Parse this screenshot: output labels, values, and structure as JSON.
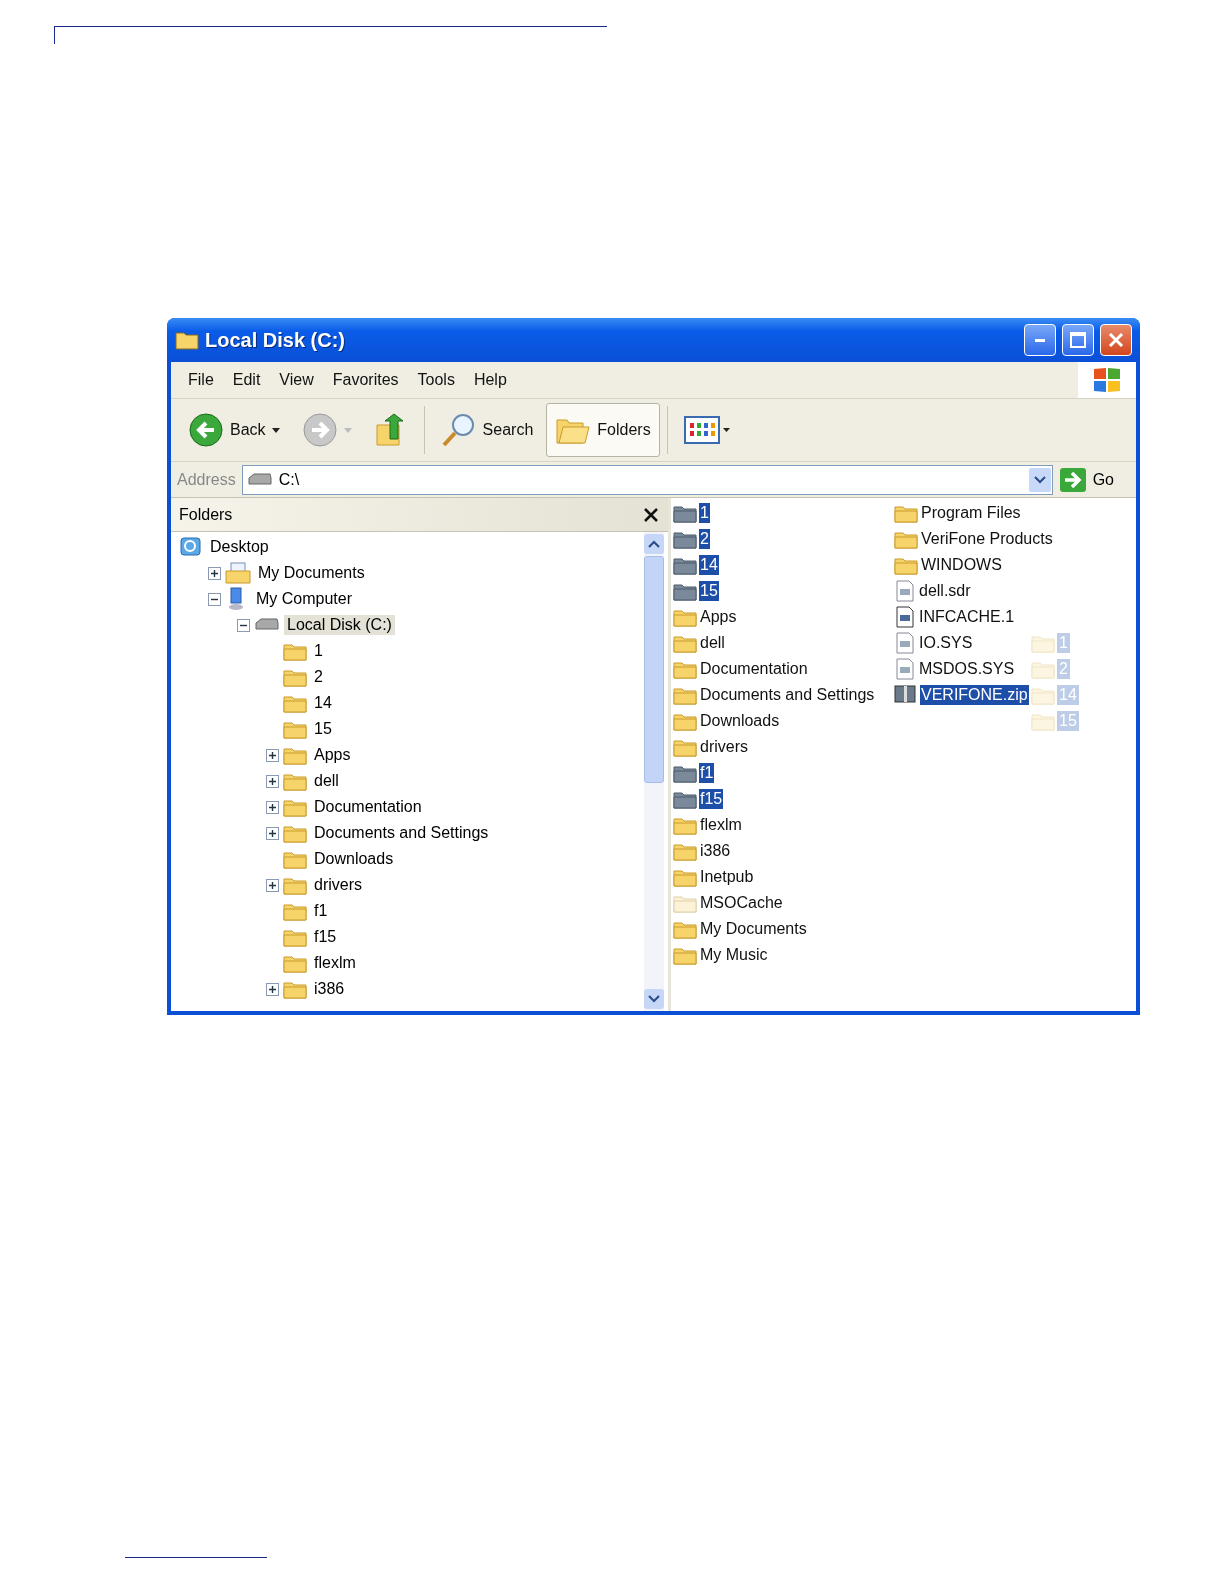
{
  "window": {
    "title": "Local Disk (C:)"
  },
  "menu": [
    "File",
    "Edit",
    "View",
    "Favorites",
    "Tools",
    "Help"
  ],
  "toolbar": [
    {
      "kind": "back",
      "label": "Back",
      "disabled": false
    },
    {
      "kind": "forward",
      "disabled": true
    },
    {
      "kind": "up"
    },
    {
      "kind": "search",
      "label": "Search",
      "selected": false
    },
    {
      "kind": "folders",
      "label": "Folders",
      "selected": true
    },
    {
      "kind": "views"
    }
  ],
  "address": {
    "label": "Address",
    "value": "C:\\",
    "go": "Go"
  },
  "folders_pane": {
    "title": "Folders",
    "tree": [
      {
        "label": "Desktop",
        "kind": "desktop",
        "selected": false,
        "children": [
          {
            "label": "My Documents",
            "kind": "documents",
            "expanded": false,
            "selected": false
          },
          {
            "label": "My Computer",
            "kind": "computer",
            "expanded": true,
            "selected": false,
            "children": [
              {
                "label": "Local Disk (C:)",
                "kind": "drive",
                "expanded": true,
                "selected": true,
                "children": [
                  {
                    "label": "1",
                    "kind": "folder",
                    "selected": false
                  },
                  {
                    "label": "2",
                    "kind": "folder",
                    "selected": false
                  },
                  {
                    "label": "14",
                    "kind": "folder",
                    "selected": false
                  },
                  {
                    "label": "15",
                    "kind": "folder",
                    "selected": false
                  },
                  {
                    "label": "Apps",
                    "kind": "folder",
                    "expanded": false,
                    "selected": false
                  },
                  {
                    "label": "dell",
                    "kind": "folder",
                    "expanded": false,
                    "selected": false
                  },
                  {
                    "label": "Documentation",
                    "kind": "folder",
                    "expanded": false,
                    "selected": false
                  },
                  {
                    "label": "Documents and Settings",
                    "kind": "folder",
                    "expanded": false,
                    "selected": false
                  },
                  {
                    "label": "Downloads",
                    "kind": "folder",
                    "selected": false
                  },
                  {
                    "label": "drivers",
                    "kind": "folder",
                    "expanded": false,
                    "selected": false
                  },
                  {
                    "label": "f1",
                    "kind": "folder",
                    "selected": false
                  },
                  {
                    "label": "f15",
                    "kind": "folder",
                    "selected": false
                  },
                  {
                    "label": "flexlm",
                    "kind": "folder",
                    "selected": false
                  },
                  {
                    "label": "i386",
                    "kind": "folder",
                    "expanded": false,
                    "selected": false
                  }
                ]
              }
            ]
          }
        ]
      }
    ]
  },
  "files": [
    {
      "name": "1",
      "kind": "folder",
      "selected": true
    },
    {
      "name": "2",
      "kind": "folder",
      "selected": true
    },
    {
      "name": "14",
      "kind": "folder",
      "selected": true
    },
    {
      "name": "15",
      "kind": "folder",
      "selected": true
    },
    {
      "name": "Apps",
      "kind": "folder",
      "selected": false
    },
    {
      "name": "dell",
      "kind": "folder",
      "selected": false
    },
    {
      "name": "Documentation",
      "kind": "folder",
      "selected": false
    },
    {
      "name": "Documents and Settings",
      "kind": "folder",
      "selected": false
    },
    {
      "name": "Downloads",
      "kind": "folder",
      "selected": false
    },
    {
      "name": "drivers",
      "kind": "folder",
      "selected": false
    },
    {
      "name": "f1",
      "kind": "folder",
      "selected": true
    },
    {
      "name": "f15",
      "kind": "folder",
      "selected": true
    },
    {
      "name": "flexlm",
      "kind": "folder",
      "selected": false
    },
    {
      "name": "i386",
      "kind": "folder",
      "selected": false
    },
    {
      "name": "Inetpub",
      "kind": "folder",
      "selected": false
    },
    {
      "name": "MSOCache",
      "kind": "hidden-folder",
      "selected": false
    },
    {
      "name": "My Documents",
      "kind": "folder",
      "selected": false
    },
    {
      "name": "My Music",
      "kind": "folder",
      "selected": false
    },
    {
      "name": "Program Files",
      "kind": "folder",
      "selected": false
    },
    {
      "name": "VeriFone Products",
      "kind": "folder",
      "selected": false
    },
    {
      "name": "WINDOWS",
      "kind": "folder",
      "selected": false
    },
    {
      "name": "dell.sdr",
      "kind": "file",
      "selected": false
    },
    {
      "name": "INFCACHE.1",
      "kind": "system-file",
      "selected": false
    },
    {
      "name": "IO.SYS",
      "kind": "file",
      "selected": false
    },
    {
      "name": "MSDOS.SYS",
      "kind": "file",
      "selected": false
    },
    {
      "name": "VERIFONE.zip",
      "kind": "zip",
      "selected": true
    }
  ],
  "drag_ghost": [
    "1",
    "2",
    "14",
    "15"
  ]
}
